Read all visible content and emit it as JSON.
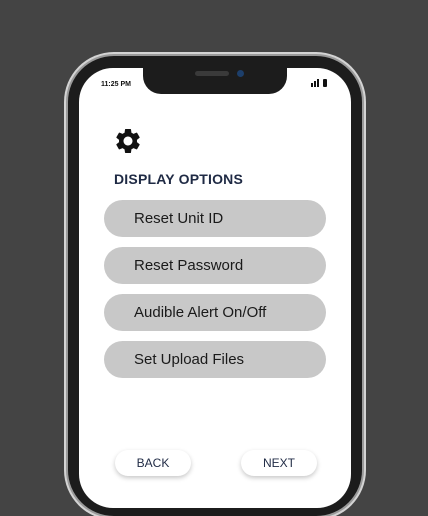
{
  "status": {
    "time": "11:25 PM"
  },
  "header": {
    "icon": "gear-icon",
    "title": "DISPLAY OPTIONS"
  },
  "menu": {
    "items": [
      {
        "label": "Reset Unit ID"
      },
      {
        "label": "Reset Password"
      },
      {
        "label": "Audible Alert On/Off"
      },
      {
        "label": "Set Upload Files"
      }
    ]
  },
  "nav": {
    "back_label": "BACK",
    "next_label": "NEXT"
  },
  "colors": {
    "background": "#444444",
    "button": "#c8c8c8",
    "title": "#1f2a44"
  }
}
